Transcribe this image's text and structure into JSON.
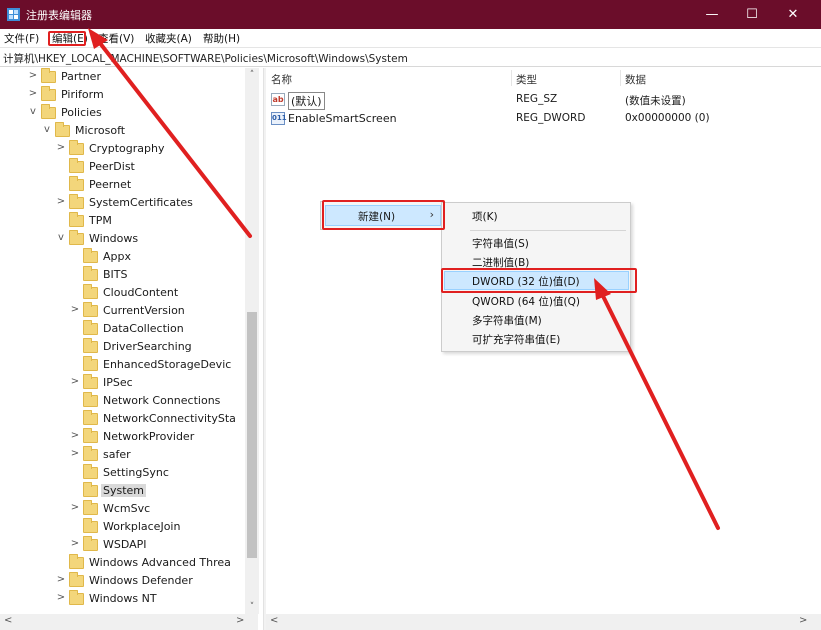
{
  "window": {
    "title": "注册表编辑器",
    "minimize": "—",
    "maximize": "☐",
    "close": "✕",
    "title_bar_color": "#6b0d2a"
  },
  "menubar": {
    "file": "文件(F)",
    "edit": "编辑(E)",
    "view": "查看(V)",
    "favorites": "收藏夹(A)",
    "help": "帮助(H)"
  },
  "address": {
    "path": "计算机\\HKEY_LOCAL_MACHINE\\SOFTWARE\\Policies\\Microsoft\\Windows\\System"
  },
  "tree": {
    "items": [
      {
        "label": "Partner",
        "chevron": ">"
      },
      {
        "label": "Piriform",
        "chevron": ">"
      },
      {
        "label": "Policies",
        "chevron": "v"
      },
      {
        "label": "Microsoft",
        "chevron": "v"
      },
      {
        "label": "Cryptography",
        "chevron": ">"
      },
      {
        "label": "PeerDist",
        "chevron": ""
      },
      {
        "label": "Peernet",
        "chevron": ""
      },
      {
        "label": "SystemCertificates",
        "chevron": ">"
      },
      {
        "label": "TPM",
        "chevron": ""
      },
      {
        "label": "Windows",
        "chevron": "v"
      },
      {
        "label": "Appx",
        "chevron": ""
      },
      {
        "label": "BITS",
        "chevron": ""
      },
      {
        "label": "CloudContent",
        "chevron": ""
      },
      {
        "label": "CurrentVersion",
        "chevron": ">"
      },
      {
        "label": "DataCollection",
        "chevron": ""
      },
      {
        "label": "DriverSearching",
        "chevron": ""
      },
      {
        "label": "EnhancedStorageDevic",
        "chevron": ""
      },
      {
        "label": "IPSec",
        "chevron": ">"
      },
      {
        "label": "Network Connections",
        "chevron": ""
      },
      {
        "label": "NetworkConnectivitySta",
        "chevron": ""
      },
      {
        "label": "NetworkProvider",
        "chevron": ">"
      },
      {
        "label": "safer",
        "chevron": ">"
      },
      {
        "label": "SettingSync",
        "chevron": ""
      },
      {
        "label": "System",
        "chevron": "",
        "selected": true
      },
      {
        "label": "WcmSvc",
        "chevron": ">"
      },
      {
        "label": "WorkplaceJoin",
        "chevron": ""
      },
      {
        "label": "WSDAPI",
        "chevron": ">"
      },
      {
        "label": "Windows Advanced Threa",
        "chevron": ""
      },
      {
        "label": "Windows Defender",
        "chevron": ">"
      },
      {
        "label": "Windows NT",
        "chevron": ">"
      }
    ]
  },
  "values": {
    "columns": {
      "name": "名称",
      "type": "类型",
      "data": "数据"
    },
    "rows": [
      {
        "icon": "ab",
        "name": "(默认)",
        "type": "REG_SZ",
        "data": "(数值未设置)"
      },
      {
        "icon": "011",
        "name": "EnableSmartScreen",
        "type": "REG_DWORD",
        "data": "0x00000000 (0)"
      }
    ]
  },
  "context_menu": {
    "new_label": "新建(N)",
    "new_arrow": "›"
  },
  "submenu": {
    "items": [
      {
        "label": "项(K)"
      },
      {
        "label": "字符串值(S)"
      },
      {
        "label": "二进制值(B)"
      },
      {
        "label": "DWORD (32 位)值(D)",
        "highlighted": true
      },
      {
        "label": "QWORD (64 位)值(Q)"
      },
      {
        "label": "多字符串值(M)"
      },
      {
        "label": "可扩充字符串值(E)"
      }
    ]
  },
  "scroll": {
    "up": "˄",
    "down": "˅",
    "left": "<",
    "right": ">"
  },
  "annotation_color": "#e02020"
}
